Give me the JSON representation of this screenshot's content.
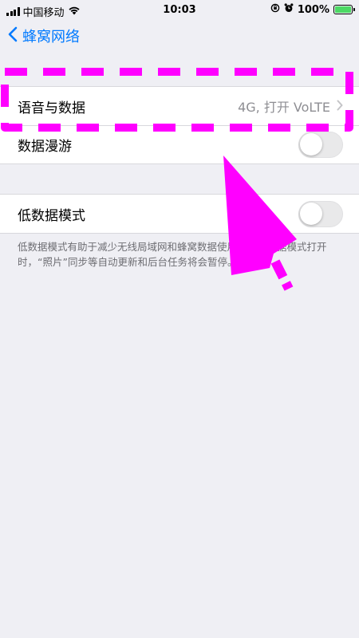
{
  "status_bar": {
    "carrier": "中国移动",
    "time": "10:03",
    "battery_pct": "100%",
    "icons": [
      "signal-icon",
      "wifi-icon",
      "rotation-lock-icon",
      "alarm-icon",
      "battery-icon"
    ]
  },
  "nav": {
    "back_label": "蜂窝网络"
  },
  "group1": {
    "rows": [
      {
        "label": "语音与数据",
        "value": "4G, 打开 VoLTE"
      },
      {
        "label": "数据漫游",
        "toggle_on": false
      }
    ]
  },
  "group2": {
    "rows": [
      {
        "label": "低数据模式",
        "toggle_on": false
      }
    ],
    "footer": "低数据模式有助于减少无线局域网和蜂窝数据使用量。低数据模式打开时，“照片”同步等自动更新和后台任务将会暂停。"
  },
  "colors": {
    "accent": "#007aff",
    "annotation": "#ff00ff",
    "background": "#efeff4"
  }
}
